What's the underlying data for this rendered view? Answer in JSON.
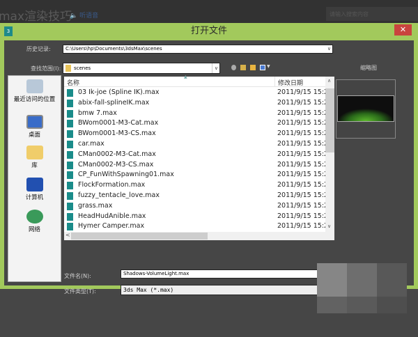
{
  "site": {
    "title": "max渲染技巧",
    "listen": "🔈 听语音",
    "search_placeholder": "请输入搜索内容"
  },
  "dialog": {
    "title": "打开文件",
    "close": "✕",
    "history_label": "历史记录:",
    "history_value": "C:\\Users\\hp\\Documents\\3dsMax\\scenes",
    "lookin_label": "查找范围(I):",
    "lookin_value": "scenes",
    "thumbnail_label": "缩略图",
    "places": [
      "最近访问的位置",
      "桌面",
      "库",
      "计算机",
      "网络"
    ],
    "columns": {
      "name": "名称",
      "date": "修改日期"
    },
    "files": [
      {
        "name": "03 Ik-joe (Spline IK).max",
        "date": "2011/9/15 15:2"
      },
      {
        "name": "abix-fall-splineIK.max",
        "date": "2011/9/15 15:2"
      },
      {
        "name": "bmw 7.max",
        "date": "2011/9/15 15:2"
      },
      {
        "name": "BWom0001-M3-Cat.max",
        "date": "2011/9/15 15:2"
      },
      {
        "name": "BWom0001-M3-CS.max",
        "date": "2011/9/15 15:2"
      },
      {
        "name": "car.max",
        "date": "2011/9/15 15:2"
      },
      {
        "name": "CMan0002-M3-Cat.max",
        "date": "2011/9/15 15:2"
      },
      {
        "name": "CMan0002-M3-CS.max",
        "date": "2011/9/15 15:2"
      },
      {
        "name": "CP_FunWithSpawning01.max",
        "date": "2011/9/15 15:2"
      },
      {
        "name": "FlockFormation.max",
        "date": "2011/9/15 15:2"
      },
      {
        "name": "fuzzy_tentacle_love.max",
        "date": "2011/9/15 15:2"
      },
      {
        "name": "grass.max",
        "date": "2011/9/15 15:2"
      },
      {
        "name": "HeadHudAnible.max",
        "date": "2011/9/15 15:2"
      },
      {
        "name": "Hymer Camper.max",
        "date": "2011/9/15 15:2"
      }
    ],
    "filename_label": "文件名(N):",
    "filename_value": "Shadows-VolumeLight.max",
    "filetype_label": "文件类型(T):",
    "filetype_value": "3ds Max (*.max)"
  }
}
